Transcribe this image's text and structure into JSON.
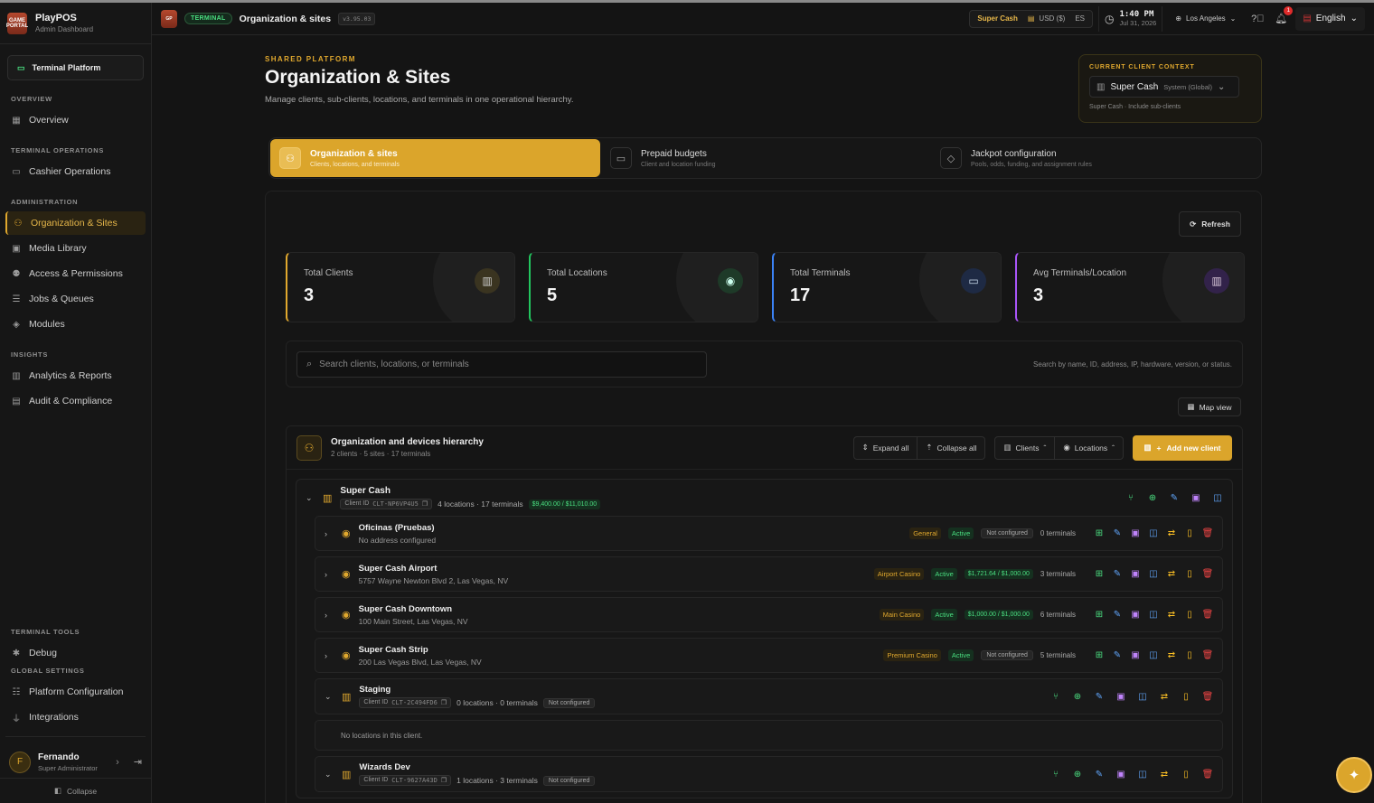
{
  "brand": {
    "name": "PlayPOS",
    "subtitle": "Admin Dashboard",
    "logo_text": "GAME PORTAL"
  },
  "sidebar": {
    "platform_button": "Terminal Platform",
    "sections": [
      {
        "title": "OVERVIEW",
        "items": [
          {
            "label": "Overview",
            "icon": "grid-icon"
          }
        ]
      },
      {
        "title": "TERMINAL OPERATIONS",
        "items": [
          {
            "label": "Cashier Operations",
            "icon": "cash-icon"
          }
        ]
      },
      {
        "title": "ADMINISTRATION",
        "items": [
          {
            "label": "Organization & Sites",
            "icon": "hierarchy-icon",
            "active": true
          },
          {
            "label": "Media Library",
            "icon": "image-icon"
          },
          {
            "label": "Access & Permissions",
            "icon": "users-icon"
          },
          {
            "label": "Jobs & Queues",
            "icon": "list-icon"
          },
          {
            "label": "Modules",
            "icon": "layers-icon"
          }
        ]
      },
      {
        "title": "INSIGHTS",
        "items": [
          {
            "label": "Analytics & Reports",
            "icon": "bar-chart-icon"
          },
          {
            "label": "Audit & Compliance",
            "icon": "clipboard-icon"
          }
        ]
      }
    ],
    "tools_title": "TERMINAL TOOLS",
    "tools": [
      {
        "label": "Debug",
        "icon": "bug-icon"
      }
    ],
    "global_title": "GLOBAL SETTINGS",
    "global": [
      {
        "label": "Platform Configuration",
        "icon": "sliders-icon"
      },
      {
        "label": "Integrations",
        "icon": "plug-icon"
      }
    ],
    "user": {
      "initial": "F",
      "name": "Fernando",
      "role": "Super Administrator"
    },
    "collapse_label": "Collapse"
  },
  "topbar": {
    "tag": "TERMINAL",
    "title": "Organization & sites",
    "version": "v3.95.03",
    "client": "Super Cash",
    "currency": "USD ($)",
    "lang_code": "ES",
    "time": "1:40 PM",
    "date": "Jul 31, 2026",
    "timezone": "Los Angeles",
    "notifications": "1",
    "language": "English"
  },
  "page": {
    "eyebrow": "SHARED PLATFORM",
    "title": "Organization & Sites",
    "subtitle": "Manage clients, sub-clients, locations, and terminals in one operational hierarchy."
  },
  "context": {
    "label": "CURRENT CLIENT CONTEXT",
    "client": "Super Cash",
    "scope": "System (Global)",
    "footer": "Super Cash · Include sub-clients"
  },
  "tabs": [
    {
      "title": "Organization & sites",
      "sub": "Clients, locations, and terminals",
      "active": true
    },
    {
      "title": "Prepaid budgets",
      "sub": "Client and location funding"
    },
    {
      "title": "Jackpot configuration",
      "sub": "Pools, odds, funding, and assignment rules"
    }
  ],
  "refresh_label": "Refresh",
  "stats": [
    {
      "label": "Total Clients",
      "value": "3",
      "color": "#e0a82e"
    },
    {
      "label": "Total Locations",
      "value": "5",
      "color": "#22c55e"
    },
    {
      "label": "Total Terminals",
      "value": "17",
      "color": "#3b82f6"
    },
    {
      "label": "Avg Terminals/Location",
      "value": "3",
      "color": "#a855f7"
    }
  ],
  "search": {
    "placeholder": "Search clients, locations, or terminals",
    "hint": "Search by name, ID, address, IP, hardware, version, or status."
  },
  "map_view_label": "Map view",
  "hierarchy": {
    "title": "Organization and devices hierarchy",
    "summary": "2 clients · 5 sites · 17 terminals",
    "expand_all": "Expand all",
    "collapse_all": "Collapse all",
    "clients_filter": "Clients",
    "locations_filter": "Locations",
    "add_client": "Add new client"
  },
  "clients": [
    {
      "name": "Super Cash",
      "id_label": "Client ID",
      "id": "CLT-NP6VP4U5",
      "meta": "4 locations · 17 terminals",
      "budget": "$9,400.00 / $11,010.00"
    },
    {
      "name": "Staging",
      "id_label": "Client ID",
      "id": "CLT-2C494FD6",
      "meta": "0 locations · 0 terminals",
      "status": "Not configured",
      "empty": "No locations in this client."
    },
    {
      "name": "Wizards Dev",
      "id_label": "Client ID",
      "id": "CLT-9627A43D",
      "meta": "1 locations · 3 terminals",
      "status": "Not configured"
    }
  ],
  "locations": [
    {
      "name": "Oficinas (Pruebas)",
      "address": "No address configured",
      "type": "General",
      "status": "Active",
      "budget": "Not configured",
      "terminals": "0 terminals"
    },
    {
      "name": "Super Cash Airport",
      "address": "5757 Wayne Newton Blvd 2, Las Vegas, NV",
      "type": "Airport Casino",
      "status": "Active",
      "budget": "$1,721.64 / $1,000.00",
      "terminals": "3 terminals"
    },
    {
      "name": "Super Cash Downtown",
      "address": "100 Main Street, Las Vegas, NV",
      "type": "Main Casino",
      "status": "Active",
      "budget": "$1,000.00 / $1,000.00",
      "terminals": "6 terminals"
    },
    {
      "name": "Super Cash Strip",
      "address": "200 Las Vegas Blvd, Las Vegas, NV",
      "type": "Premium Casino",
      "status": "Active",
      "budget": "Not configured",
      "terminals": "5 terminals"
    }
  ]
}
